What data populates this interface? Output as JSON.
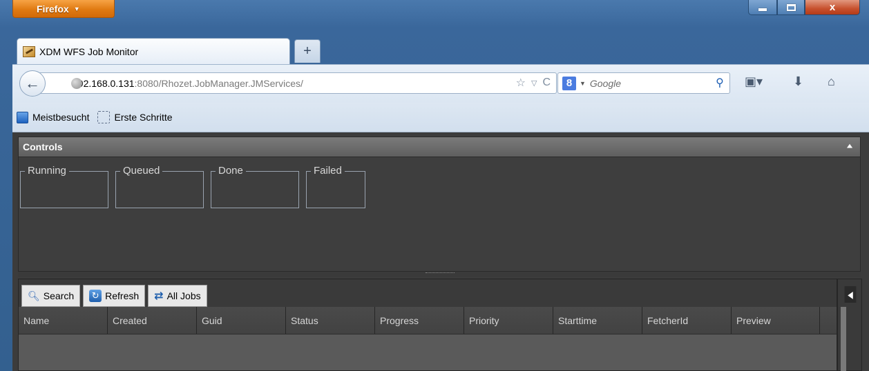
{
  "browser": {
    "menu_button": "Firefox",
    "tab_title": "XDM WFS Job Monitor",
    "new_tab": "+",
    "url_host": "192.168.0.131",
    "url_rest": ":8080/Rhozet.JobManager.JMServices/",
    "search_placeholder": "Google",
    "search_engine_badge": "8",
    "window_close": "x",
    "bookmarks": [
      "Meistbesucht",
      "Erste Schritte"
    ]
  },
  "app": {
    "controls_title": "Controls",
    "groups": [
      "Running",
      "Queued",
      "Done",
      "Failed"
    ],
    "toolbar": {
      "search": "Search",
      "refresh": "Refresh",
      "all_jobs": "All Jobs"
    },
    "columns": [
      "Name",
      "Created",
      "Guid",
      "Status",
      "Progress",
      "Priority",
      "Starttime",
      "FetcherId",
      "Preview"
    ]
  },
  "icons": {
    "back": "arrow-left-icon",
    "star": "star-icon",
    "reload": "reload-icon",
    "search": "search-icon",
    "bookmarks_menu": "bookmark-icon",
    "downloads": "download-icon",
    "home": "home-icon"
  },
  "colors": {
    "firefox_orange": "#e07a12",
    "app_background": "#3c3c3c",
    "window_blue": "#3a679b"
  }
}
